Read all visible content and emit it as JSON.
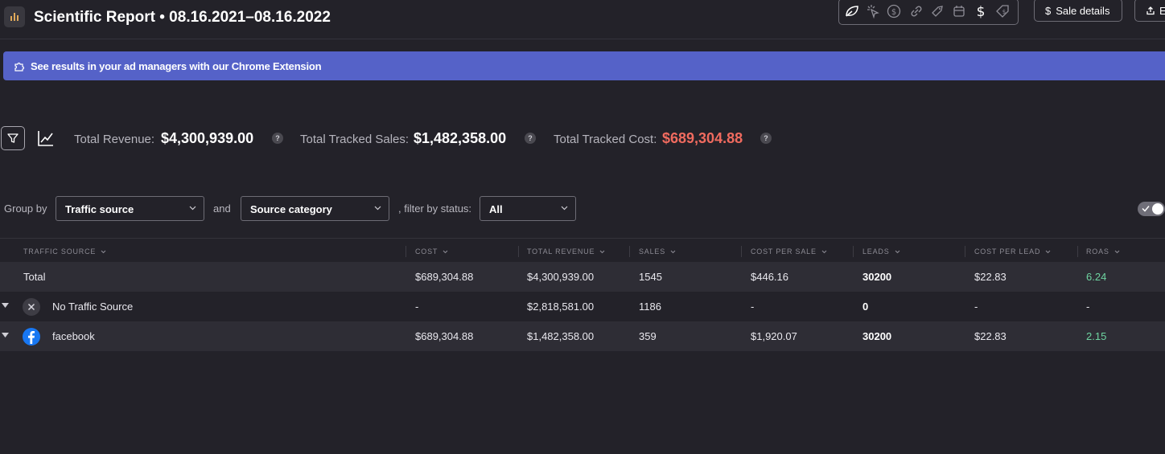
{
  "header": {
    "title": "Scientific Report • 08.16.2021–08.16.2022",
    "sale_details_label": "Sale details",
    "export_label": "E"
  },
  "banner": {
    "text": "See results in your ad managers with our Chrome Extension"
  },
  "summary": {
    "revenue_label": "Total Revenue:",
    "revenue_value": "$4,300,939.00",
    "sales_label": "Total Tracked Sales:",
    "sales_value": "$1,482,358.00",
    "cost_label": "Total Tracked Cost:",
    "cost_value": "$689,304.88",
    "help_glyph": "?"
  },
  "controls": {
    "group_by_label": "Group by",
    "group_by_value": "Traffic source",
    "and_label": "and",
    "second_group_value": "Source category",
    "filter_label": ", filter by status:",
    "status_value": "All"
  },
  "table": {
    "columns": [
      "TRAFFIC SOURCE",
      "COST",
      "TOTAL REVENUE",
      "SALES",
      "COST PER SALE",
      "LEADS",
      "COST PER LEAD",
      "ROAS"
    ],
    "total": {
      "label": "Total",
      "cost": "$689,304.88",
      "revenue": "$4,300,939.00",
      "sales": "1545",
      "cost_per_sale": "$446.16",
      "leads": "30200",
      "cost_per_lead": "$22.83",
      "roas": "6.24"
    },
    "rows": [
      {
        "source": "No Traffic Source",
        "icon": "x-circle-icon",
        "cost": "-",
        "revenue": "$2,818,581.00",
        "sales": "1186",
        "cost_per_sale": "-",
        "leads": "0",
        "cost_per_lead": "-",
        "roas": "-"
      },
      {
        "source": "facebook",
        "icon": "facebook-icon",
        "cost": "$689,304.88",
        "revenue": "$1,482,358.00",
        "sales": "359",
        "cost_per_sale": "$1,920.07",
        "leads": "30200",
        "cost_per_lead": "$22.83",
        "roas": "2.15"
      }
    ]
  },
  "colors": {
    "background": "#232229",
    "banner": "#5562c8",
    "cost_accent": "#f06b5f",
    "roas_accent": "#6ed3a0",
    "facebook_blue": "#1877f2"
  }
}
